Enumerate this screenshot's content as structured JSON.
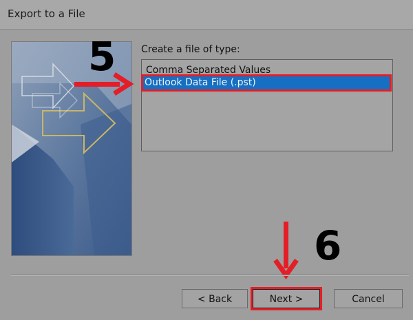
{
  "window": {
    "title": "Export to a File"
  },
  "main": {
    "type_label": "Create a file of type:",
    "file_types": [
      {
        "label": "Comma Separated Values",
        "selected": false
      },
      {
        "label": "Outlook Data File (.pst)",
        "selected": true
      }
    ]
  },
  "buttons": {
    "back": "< Back",
    "next": "Next >",
    "cancel": "Cancel"
  },
  "annotations": {
    "step_five": "5",
    "step_six": "6",
    "highlight_color": "#e41e26"
  },
  "icons": {
    "wizard_graphic": "export-wizard-graphic",
    "arrow_right": "red-arrow-right-icon",
    "arrow_down": "red-arrow-down-icon"
  }
}
